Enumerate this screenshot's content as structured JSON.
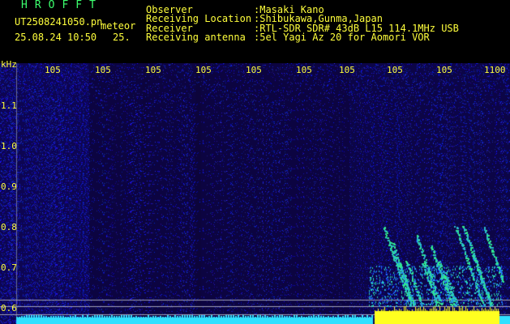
{
  "header": {
    "logo": "HROFFT",
    "filename": "UT2508241050.pn",
    "mode": "meteor",
    "datetime": "25.08.24 10:50",
    "extra": "25.",
    "fields": [
      {
        "label": "Observer",
        "value": ":Masaki Kano"
      },
      {
        "label": "Receiving Location",
        "value": ":Shibukawa,Gunma,Japan"
      },
      {
        "label": "Receiver",
        "value": ":RTL-SDR SDR# 43dB L15 114.1MHz USB"
      },
      {
        "label": "Receiving antenna",
        "value": ":5el Yagi Az 20 for Aomori VOR"
      }
    ]
  },
  "axes": {
    "y_unit": "kHz",
    "y_ticks": [
      "1.1",
      "1.0",
      "0.9",
      "0.8",
      "0.7",
      "0.6"
    ],
    "x_ticks": [
      "105",
      "105",
      "105",
      "105",
      "105",
      "105",
      "105",
      "105",
      "105",
      "1100"
    ]
  },
  "colors": {
    "header_text": "#ffff3c",
    "logo": "#3cff6e",
    "background": "#000000",
    "spectrum_low": "#06002e",
    "spectrum_noise": "#2a2aff",
    "echo_green": "#30e890",
    "baseline_cyan": "#30e0ff",
    "baseline_yellow": "#ffff20"
  }
}
